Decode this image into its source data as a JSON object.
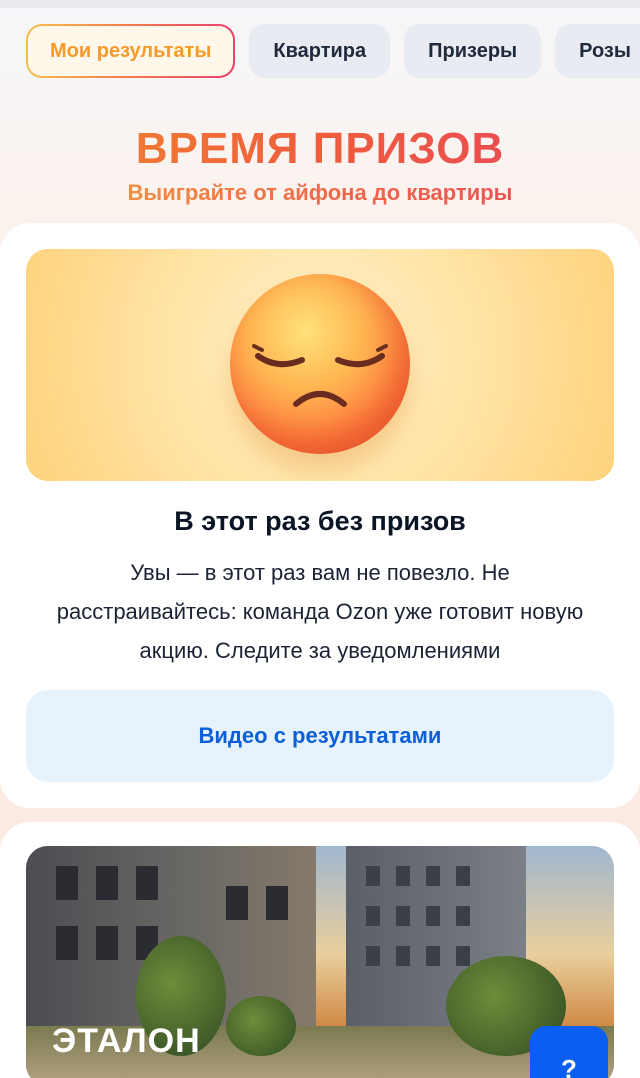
{
  "tabs": [
    {
      "label": "Мои результаты",
      "active": true
    },
    {
      "label": "Квартира",
      "active": false
    },
    {
      "label": "Призеры",
      "active": false
    },
    {
      "label": "Розы",
      "active": false
    }
  ],
  "promo": {
    "headline": "ВРЕМЯ ПРИЗОВ",
    "subline": "Выиграйте от айфона до квартиры"
  },
  "result_card": {
    "image_icon": "pensive-face-emoji",
    "title": "В этот раз без призов",
    "text": "Увы — в этот раз вам не повезло. Не расстраивайтесь: команда Ozon уже готовит новую акцию. Следите за уведомлениями",
    "button_label": "Видео с результатами"
  },
  "apartment_card": {
    "brand": "ЭТАЛОН"
  },
  "help_button": {
    "label": "?"
  },
  "colors": {
    "accent_orange": "#f28b2c",
    "accent_pink": "#e8435f",
    "link_blue": "#0d5fd8",
    "help_blue": "#0a5ef0"
  }
}
